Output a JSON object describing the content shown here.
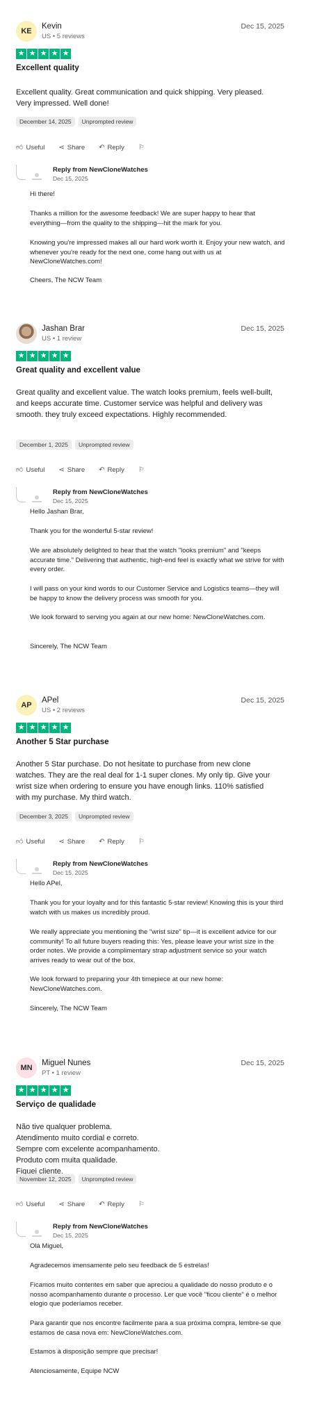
{
  "reviews": [
    {
      "initials": "KE",
      "avatar_color": "#fdf1b7",
      "name": "Kevin",
      "meta": "US • 5 reviews",
      "date": "Dec 15, 2025",
      "title": "Excellent quality",
      "body": "Excellent quality. Great communication and quick shipping. Very pleased. Very impressed. Well done!",
      "experience_date": "December 14, 2025",
      "tag": "Unprompted review",
      "actions": {
        "useful": "Useful",
        "share": "Share",
        "reply": "Reply"
      },
      "reply": {
        "from": "Reply from NewCloneWatches",
        "date": "Dec 15, 2025",
        "paragraphs": [
          "Hi there!",
          "Thanks a million for the awesome feedback! We are super happy to hear that everything—from the quality to the shipping—hit the mark for you.",
          "Knowing you're impressed makes all our hard work worth it. Enjoy your new watch, and whenever you're ready for the next one, come hang out with us at NewCloneWatches.com!",
          "Cheers, The NCW Team"
        ]
      }
    },
    {
      "initials": "",
      "avatar_color": "#e8ddd2",
      "name": "Jashan Brar",
      "meta": "US • 1 review",
      "date": "Dec 15, 2025",
      "title": "Great quality and excellent value",
      "body": "Great quality and excellent value. The watch looks premium, feels well-built, and keeps accurate time. Customer service was helpful and delivery was smooth. they truly exceed expectations. Highly recommended.",
      "experience_date": "December 1, 2025",
      "tag": "Unprompted review",
      "actions": {
        "useful": "Useful",
        "share": "Share",
        "reply": "Reply"
      },
      "reply": {
        "from": "Reply from NewCloneWatches",
        "date": "Dec 15, 2025",
        "paragraphs": [
          "Hello Jashan Brar,",
          "Thank you for the wonderful 5-star review!",
          "We are absolutely delighted to hear that the watch \"looks premium\" and \"keeps accurate time.\" Delivering that authentic, high-end feel is exactly what we strive for with every order.",
          "I will pass on your kind words to our Customer Service and Logistics teams—they will be happy to know the delivery process was smooth for you.",
          "We look forward to serving you again at our new home: NewCloneWatches.com.",
          "Sincerely, The NCW Team"
        ]
      }
    },
    {
      "initials": "AP",
      "avatar_color": "#fdf1b7",
      "name": "APel",
      "meta": "US • 2 reviews",
      "date": "Dec 15, 2025",
      "title": "Another 5 Star purchase",
      "body": "Another 5 Star purchase. Do not hesitate to purchase from new clone watches. They are the real deal for 1-1 super clones. My only tip. Give your wrist size when ordering to ensure you have enough links. 110% satisfied with my purchase. My third watch.",
      "experience_date": "December 3, 2025",
      "tag": "Unprompted review",
      "actions": {
        "useful": "Useful",
        "share": "Share",
        "reply": "Reply"
      },
      "reply": {
        "from": "Reply from NewCloneWatches",
        "date": "Dec 15, 2025",
        "paragraphs": [
          "Hello APel,",
          "Thank you for your loyalty and for this fantastic 5-star review! Knowing this is your third watch with us makes us incredibly proud.",
          "We really appreciate you mentioning the \"wrist size\" tip—it is excellent advice for our community! To all future buyers reading this: Yes, please leave your wrist size in the order notes. We provide a complimentary strap adjustment service so your watch arrives ready to wear out of the box.",
          "We look forward to preparing your 4th timepiece at our new home: NewCloneWatches.com.",
          "Sincerely, The NCW Team"
        ]
      }
    },
    {
      "initials": "MN",
      "avatar_color": "#fde0e6",
      "name": "Miguel Nunes",
      "meta": "PT • 1 review",
      "date": "Dec 15, 2025",
      "title": "Serviço de qualidade",
      "body": "Não tive qualquer problema.\nAtendimento muito cordial e correto.\nSempre com excelente acompanhamento.\nProduto com muita qualidade.\nFiquei cliente.",
      "experience_date": "November 12, 2025",
      "tag": "Unprompted review",
      "actions": {
        "useful": "Useful",
        "share": "Share",
        "reply": "Reply"
      },
      "reply": {
        "from": "Reply from NewCloneWatches",
        "date": "Dec 15, 2025",
        "paragraphs": [
          "Olá Miguel,",
          "Agradecemos imensamente pelo seu feedback de 5 estrelas!",
          "Ficamos muito contentes em saber que apreciou a qualidade do nosso produto e o nosso acompanhamento durante o processo. Ler que você \"ficou cliente\" é o melhor elogio que poderíamos receber.",
          "Para garantir que nos encontre facilmente para a sua próxima compra, lembre-se que estamos de casa nova em: NewCloneWatches.com.",
          "Estamos à disposição sempre que precisar!",
          "Atenciosamente, Equipe NCW"
        ]
      }
    }
  ]
}
